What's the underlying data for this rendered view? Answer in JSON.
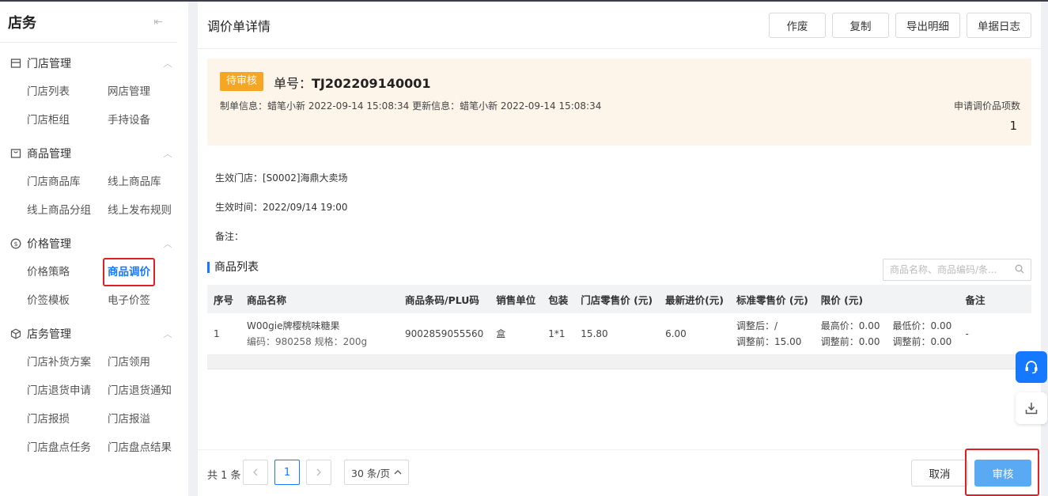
{
  "sidebar": {
    "title": "店务",
    "groups": [
      {
        "label": "门店管理",
        "icon": "store-icon",
        "items": [
          "门店列表",
          "网店管理",
          "门店柜组",
          "手持设备"
        ]
      },
      {
        "label": "商品管理",
        "icon": "bag-icon",
        "items": [
          "门店商品库",
          "线上商品库",
          "线上商品分组",
          "线上发布规则"
        ]
      },
      {
        "label": "价格管理",
        "icon": "price-icon",
        "items": [
          "价格策略",
          "商品调价",
          "价签模板",
          "电子价签"
        ]
      },
      {
        "label": "店务管理",
        "icon": "cube-icon",
        "items": [
          "门店补货方案",
          "门店领用",
          "门店退货申请",
          "门店退货通知",
          "门店报损",
          "门店报溢",
          "门店盘点任务",
          "门店盘点结果"
        ]
      }
    ]
  },
  "main": {
    "title": "调价单详情",
    "buttons": {
      "void": "作废",
      "copy": "复制",
      "export": "导出明细",
      "log": "单据日志"
    }
  },
  "banner": {
    "status": "待审核",
    "order_label": "单号：",
    "order_no": "TJ202209140001",
    "meta": "制单信息：蜡笔小新 2022-09-14 15:08:34 更新信息：蜡笔小新 2022-09-14 15:08:34",
    "count_label": "申请调价品项数",
    "count_value": "1"
  },
  "info": {
    "store": "生效门店：[S0002]海鼎大卖场",
    "time": "生效时间：2022/09/14 19:00",
    "remark": "备注："
  },
  "list": {
    "title": "商品列表",
    "search_placeholder": "商品名称、商品编码/条...",
    "headers": [
      "序号",
      "商品名称",
      "商品条码/PLU码",
      "销售单位",
      "包装",
      "门店零售价 (元)",
      "最新进价(元)",
      "标准零售价 (元)",
      "限价 (元)",
      "",
      "备注"
    ],
    "rows": [
      {
        "no": "1",
        "name": "W00gie牌樱桃味糖果",
        "code_spec": "编码：980258 规格：200g",
        "barcode": "9002859055560",
        "unit": "盒",
        "pack": "1*1",
        "store_price": "15.80",
        "last_cost": "6.00",
        "std_after": "调整后：/",
        "std_before": "调整前：15.00",
        "max_after": "最高价：0.00",
        "max_before": "调整前：0.00",
        "min_after": "最低价：0.00",
        "min_before": "调整前：0.00",
        "remark": "-"
      }
    ]
  },
  "footer": {
    "total": "共 1 条",
    "current_page": "1",
    "page_size": "30 条/页",
    "cancel": "取消",
    "approve": "审核"
  }
}
